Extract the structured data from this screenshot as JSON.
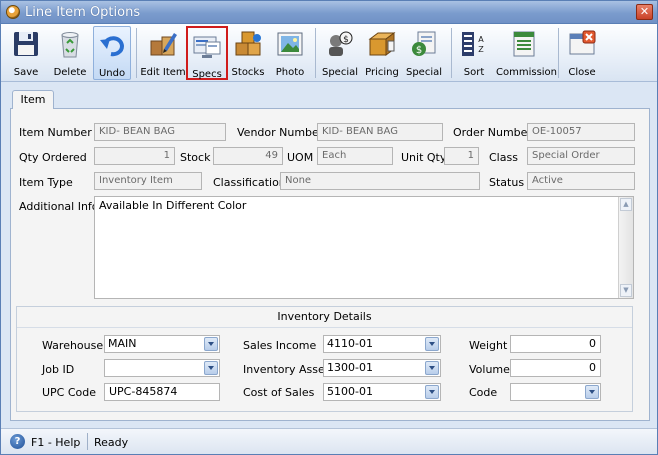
{
  "window": {
    "title": "Line Item Options",
    "close_glyph": "✕"
  },
  "toolbar": {
    "buttons": [
      {
        "label": "Save",
        "icon": "floppy-disk-icon"
      },
      {
        "label": "Delete",
        "icon": "recycle-bin-icon"
      },
      {
        "label": "Undo",
        "icon": "undo-arrow-icon"
      },
      {
        "label": "Edit Item",
        "icon": "edit-item-icon"
      },
      {
        "label": "Specs",
        "icon": "specs-icon"
      },
      {
        "label": "Stocks",
        "icon": "stocks-boxes-icon"
      },
      {
        "label": "Photo",
        "icon": "photo-icon"
      },
      {
        "label": "Special",
        "icon": "special-person-icon"
      },
      {
        "label": "Pricing",
        "icon": "pricing-icon"
      },
      {
        "label": "Special",
        "icon": "special-document-icon"
      },
      {
        "label": "Sort",
        "icon": "sort-az-icon"
      },
      {
        "label": "Commission",
        "icon": "commission-icon"
      },
      {
        "label": "Close",
        "icon": "close-window-icon"
      }
    ]
  },
  "tabs": {
    "item": "Item"
  },
  "item": {
    "item_number_label": "Item Number",
    "item_number": "KID- BEAN BAG",
    "vendor_number_label": "Vendor Number",
    "vendor_number": "KID- BEAN BAG",
    "order_number_label": "Order Number",
    "order_number": "OE-10057",
    "qty_ordered_label": "Qty Ordered",
    "qty_ordered": "1",
    "stock_label": "Stock",
    "stock": "49",
    "uom_label": "UOM",
    "uom": "Each",
    "unit_qty_label": "Unit Qty",
    "unit_qty": "1",
    "class_label": "Class",
    "class": "Special Order",
    "item_type_label": "Item Type",
    "item_type": "Inventory Item",
    "classification_label": "Classification",
    "classification": "None",
    "status_label": "Status",
    "status": "Active",
    "additional_info_label": "Additional Info",
    "additional_info": "Available In Different Color"
  },
  "inventory": {
    "title": "Inventory Details",
    "warehouse_label": "Warehouse",
    "warehouse": "MAIN",
    "job_id_label": "Job ID",
    "job_id": "",
    "upc_code_label": "UPC Code",
    "upc_code": "UPC-845874",
    "sales_income_label": "Sales Income",
    "sales_income": "4110-01",
    "inventory_assets_label": "Inventory Assets",
    "inventory_assets": "1300-01",
    "cost_of_sales_label": "Cost of Sales",
    "cost_of_sales": "5100-01",
    "weight_label": "Weight",
    "weight": "0",
    "volume_label": "Volume",
    "volume": "0",
    "code_label": "Code",
    "code": ""
  },
  "statusbar": {
    "help": "F1 - Help",
    "status": "Ready"
  }
}
